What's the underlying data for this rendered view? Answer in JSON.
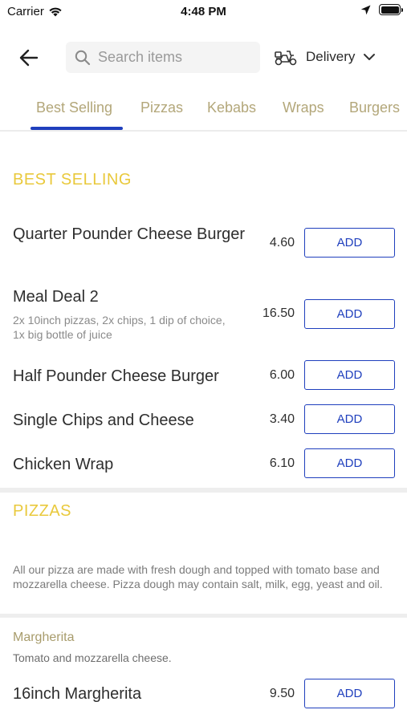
{
  "status_bar": {
    "carrier": "Carrier",
    "time": "4:48 PM"
  },
  "header": {
    "search_placeholder": "Search items",
    "delivery_label": "Delivery"
  },
  "tabs": [
    {
      "label": "Best Selling",
      "active": true
    },
    {
      "label": "Pizzas"
    },
    {
      "label": "Kebabs"
    },
    {
      "label": "Wraps"
    },
    {
      "label": "Burgers"
    }
  ],
  "colors": {
    "accent": "#1f3fbd",
    "section_title": "#e9c93c",
    "tab_text": "#b3a77a"
  },
  "best_selling": {
    "title": "BEST SELLING",
    "items": [
      {
        "name": "Quarter Pounder Cheese Burger",
        "price": "4.60",
        "add_label": "ADD"
      },
      {
        "name": "Meal Deal 2",
        "description": "2x 10inch pizzas, 2x chips, 1 dip of choice, 1x big bottle of juice",
        "price": "16.50",
        "add_label": "ADD"
      },
      {
        "name": "Half Pounder Cheese Burger",
        "price": "6.00",
        "add_label": "ADD"
      },
      {
        "name": "Single Chips and Cheese",
        "price": "3.40",
        "add_label": "ADD"
      },
      {
        "name": "Chicken Wrap",
        "price": "6.10",
        "add_label": "ADD"
      }
    ]
  },
  "pizzas": {
    "title": "PIZZAS",
    "intro": "All our pizza are made with fresh dough and topped with tomato base and mozzarella cheese. Pizza dough may contain salt, milk, egg, yeast and oil.",
    "subsection": {
      "title": "Margherita",
      "description": "Tomato and mozzarella cheese.",
      "items": [
        {
          "name": "16inch Margherita",
          "price": "9.50",
          "add_label": "ADD"
        }
      ]
    }
  }
}
